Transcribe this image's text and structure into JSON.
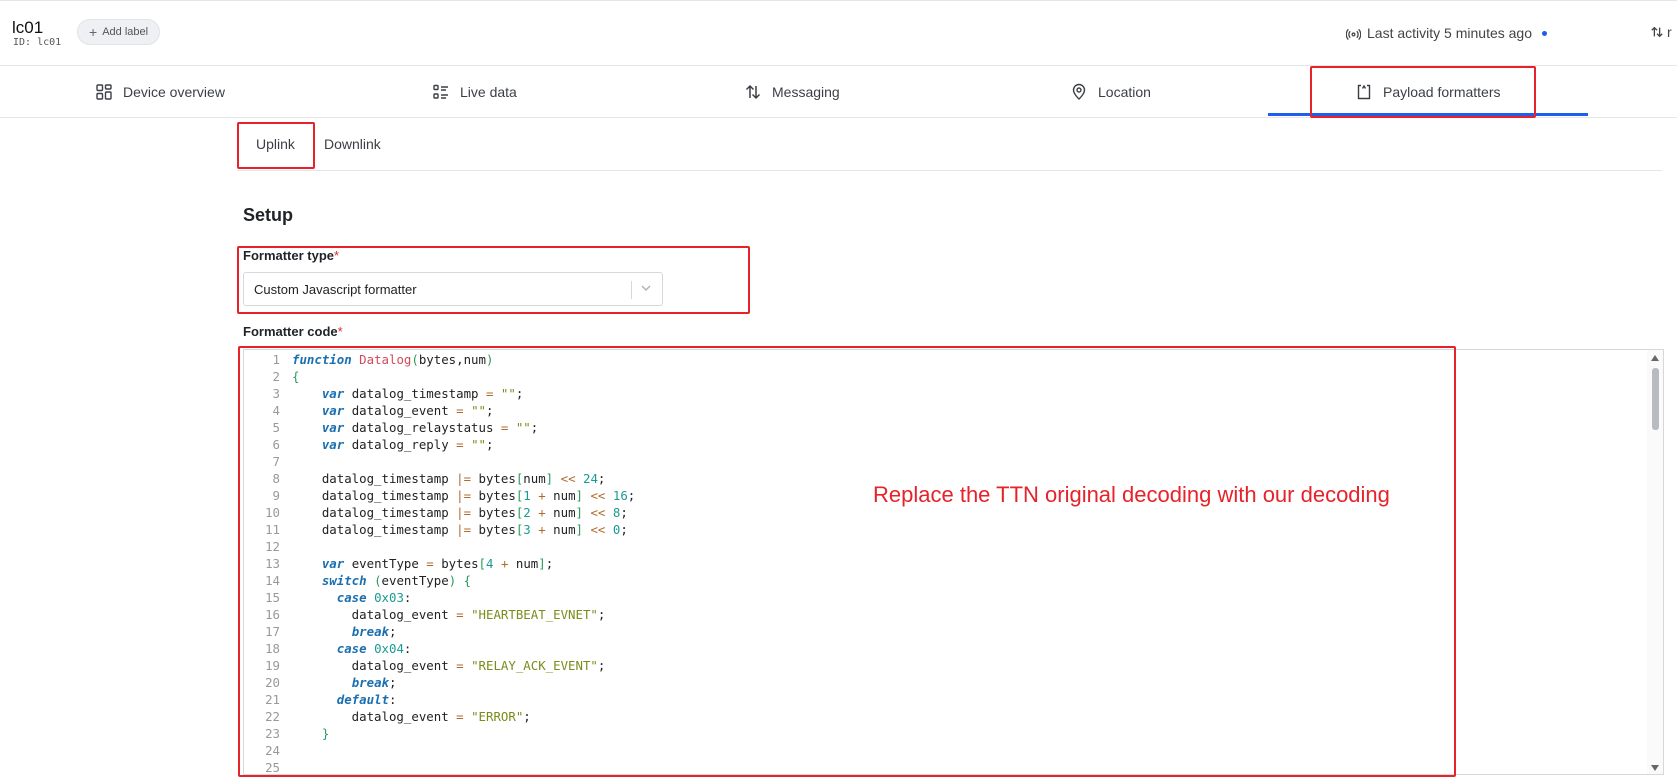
{
  "header": {
    "device_title": "lc01",
    "device_id": "ID: lc01",
    "add_label": "Add label",
    "last_activity": "Last activity 5 minutes ago"
  },
  "tabs": [
    {
      "label": "Device overview",
      "icon": "grid-icon"
    },
    {
      "label": "Live data",
      "icon": "list-icon"
    },
    {
      "label": "Messaging",
      "icon": "arrows-up-down-icon"
    },
    {
      "label": "Location",
      "icon": "map-pin-icon"
    },
    {
      "label": "Payload formatters",
      "icon": "formatter-icon",
      "active": true
    }
  ],
  "subtabs": {
    "uplink": "Uplink",
    "downlink": "Downlink",
    "active": "Uplink"
  },
  "setup": {
    "title": "Setup",
    "formatter_type_label": "Formatter type",
    "formatter_type_value": "Custom Javascript formatter",
    "formatter_code_label": "Formatter code",
    "required_mark": "*"
  },
  "code": [
    "function Datalog(bytes,num)",
    "{",
    "    var datalog_timestamp = \"\";",
    "    var datalog_event = \"\";",
    "    var datalog_relaystatus = \"\";",
    "    var datalog_reply = \"\";",
    "",
    "    datalog_timestamp |= bytes[num] << 24;",
    "    datalog_timestamp |= bytes[1 + num] << 16;",
    "    datalog_timestamp |= bytes[2 + num] << 8;",
    "    datalog_timestamp |= bytes[3 + num] << 0;",
    "",
    "    var eventType = bytes[4 + num];",
    "    switch (eventType) {",
    "      case 0x03:",
    "        datalog_event = \"HEARTBEAT_EVNET\";",
    "        break;",
    "      case 0x04:",
    "        datalog_event = \"RELAY_ACK_EVENT\";",
    "        break;",
    "      default:",
    "        datalog_event = \"ERROR\";",
    "    }",
    "",
    ""
  ],
  "annotation": "Replace the TTN original decoding with our decoding",
  "colors": {
    "accent": "#1e5df0",
    "highlight": "#e8222a"
  }
}
